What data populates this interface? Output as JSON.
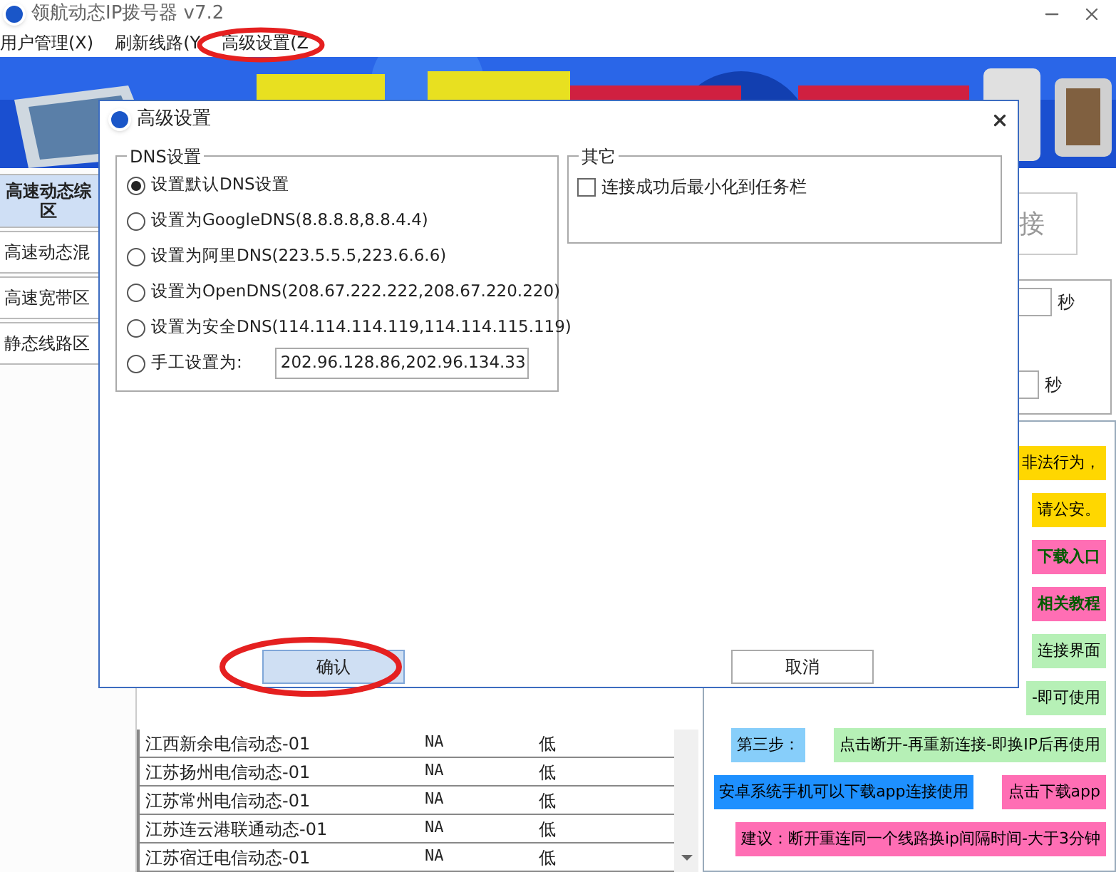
{
  "window": {
    "title": "领航动态IP拨号器 v7.2"
  },
  "menu": [
    {
      "label": "用户管理(X)"
    },
    {
      "label": "刷新线路(Y"
    },
    {
      "label": "高级设置(Z"
    }
  ],
  "sidebar": {
    "items": [
      {
        "label": "高速动态综区",
        "selected": true
      },
      {
        "label": "高速动态混",
        "selected": false
      },
      {
        "label": "高速宽带区",
        "selected": false
      },
      {
        "label": "静态线路区",
        "selected": false
      }
    ]
  },
  "connect_button": {
    "label": "接"
  },
  "interval_fields": [
    {
      "unit": "秒"
    },
    {
      "unit": "秒"
    }
  ],
  "notices": [
    {
      "cells": [
        {
          "text": "非法行为，",
          "color": "#ffd700",
          "kind": "plain"
        }
      ]
    },
    {
      "cells": [
        {
          "text": "请公安。",
          "color": "#ffd700",
          "kind": "plain"
        }
      ]
    },
    {
      "cells": [
        {
          "text": "下载入口",
          "color": "#ff6eb4",
          "kind": "link"
        }
      ]
    },
    {
      "cells": [
        {
          "text": "相关教程",
          "color": "#ff6eb4",
          "kind": "link"
        }
      ]
    },
    {
      "cells": [
        {
          "text": "连接界面",
          "color": "#b6f0b6",
          "kind": "plain"
        }
      ]
    },
    {
      "cells": [
        {
          "text": "-即可使用",
          "color": "#b6f0b6",
          "kind": "plain"
        }
      ]
    },
    {
      "cells": [
        {
          "text": "第三步：",
          "color": "#87cefa",
          "kind": "plain"
        },
        {
          "text": "点击断开-再重新连接-即换IP后再使用",
          "color": "#b6f0b6",
          "kind": "plain"
        }
      ]
    },
    {
      "cells": [
        {
          "text": "安卓系统手机可以下载app连接使用",
          "color": "#1e90ff",
          "kind": "plain"
        },
        {
          "text": "点击下载app",
          "color": "#ff6eb4",
          "kind": "plain"
        }
      ]
    },
    {
      "cells": [
        {
          "text": "建议：断开重连同一个线路换ip间隔时间-大于3分钟",
          "color": "#ff6eb4",
          "kind": "plain"
        }
      ]
    }
  ],
  "table": {
    "rows": [
      {
        "name": "江西新余电信动态-01",
        "column_2": "NA",
        "column_3": "低"
      },
      {
        "name": "江苏扬州电信动态-01",
        "column_2": "NA",
        "column_3": "低"
      },
      {
        "name": "江苏常州电信动态-01",
        "column_2": "NA",
        "column_3": "低"
      },
      {
        "name": "江苏连云港联通动态-01",
        "column_2": "NA",
        "column_3": "低"
      },
      {
        "name": "江苏宿迁电信动态-01",
        "column_2": "NA",
        "column_3": "低"
      }
    ]
  },
  "dialog": {
    "title": "高级设置",
    "dns_group": {
      "title": "DNS设置",
      "options": [
        {
          "label": "设置默认DNS设置",
          "selected": true,
          "kind": "plain"
        },
        {
          "label": "设置为GoogleDNS(8.8.8.8,8.8.4.4)",
          "selected": false,
          "kind": "plain"
        },
        {
          "label": "设置为阿里DNS(223.5.5.5,223.6.6.6)",
          "selected": false,
          "kind": "plain"
        },
        {
          "label": "设置为OpenDNS(208.67.222.222,208.67.220.220)",
          "selected": false,
          "kind": "plain"
        },
        {
          "label": "设置为安全DNS(114.114.114.119,114.114.115.119)",
          "selected": false,
          "kind": "plain"
        },
        {
          "label": "手工设置为:",
          "selected": false,
          "kind": "manual",
          "value": "202.96.128.86,202.96.134.33"
        }
      ]
    },
    "other_group": {
      "title": "其它",
      "options": [
        {
          "label": "连接成功后最小化到任务栏",
          "checked": false
        }
      ]
    },
    "buttons": [
      {
        "label": "确认",
        "selected": true
      },
      {
        "label": "取消",
        "selected": false
      }
    ]
  }
}
